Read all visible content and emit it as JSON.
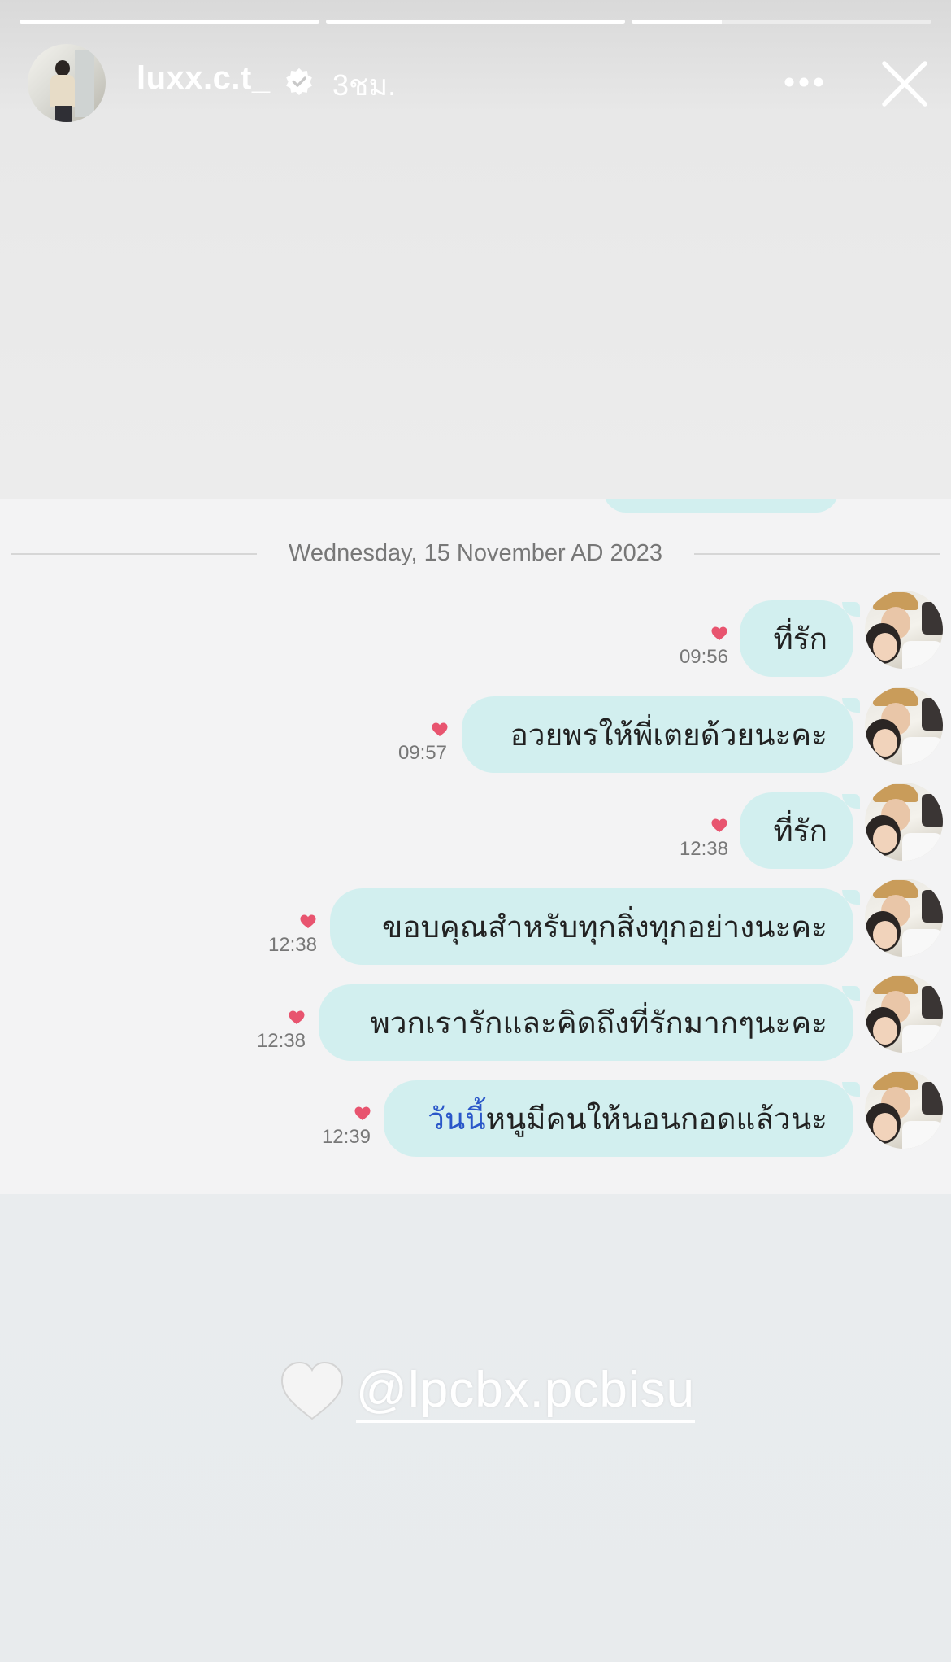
{
  "story": {
    "progress": [
      1.0,
      1.0,
      0.3
    ],
    "username": "luxx.c.t_",
    "time_ago": "3ชม.",
    "verified": true
  },
  "chat": {
    "date_label": "Wednesday, 15 November AD 2023",
    "messages": [
      {
        "text": "ที่รัก",
        "time": "09:56",
        "liked": true
      },
      {
        "text": "อวยพรให้พี่เตยด้วยนะคะ",
        "time": "09:57",
        "liked": true
      },
      {
        "text": "ที่รัก",
        "time": "12:38",
        "liked": true
      },
      {
        "text": "ขอบคุณสำหรับทุกสิ่งทุกอย่างนะคะ",
        "time": "12:38",
        "liked": true
      },
      {
        "text": "พวกเรารักและคิดถึงที่รักมากๆนะคะ",
        "time": "12:38",
        "liked": true
      },
      {
        "highlight": "วันนี้",
        "text": "หนูมีคนให้นอนกอดแล้วนะ",
        "time": "12:39",
        "liked": true
      }
    ]
  },
  "mention": {
    "emoji": "white-heart",
    "handle": "@lpcbx.pcbisu"
  },
  "colors": {
    "bubble": "#d2efef",
    "heart": "#e8546f",
    "highlight": "#2a57c9",
    "panel": "#f3f3f4"
  },
  "icons": [
    "verified-badge-icon",
    "more-icon",
    "close-icon",
    "heart-icon",
    "white-heart-icon"
  ]
}
